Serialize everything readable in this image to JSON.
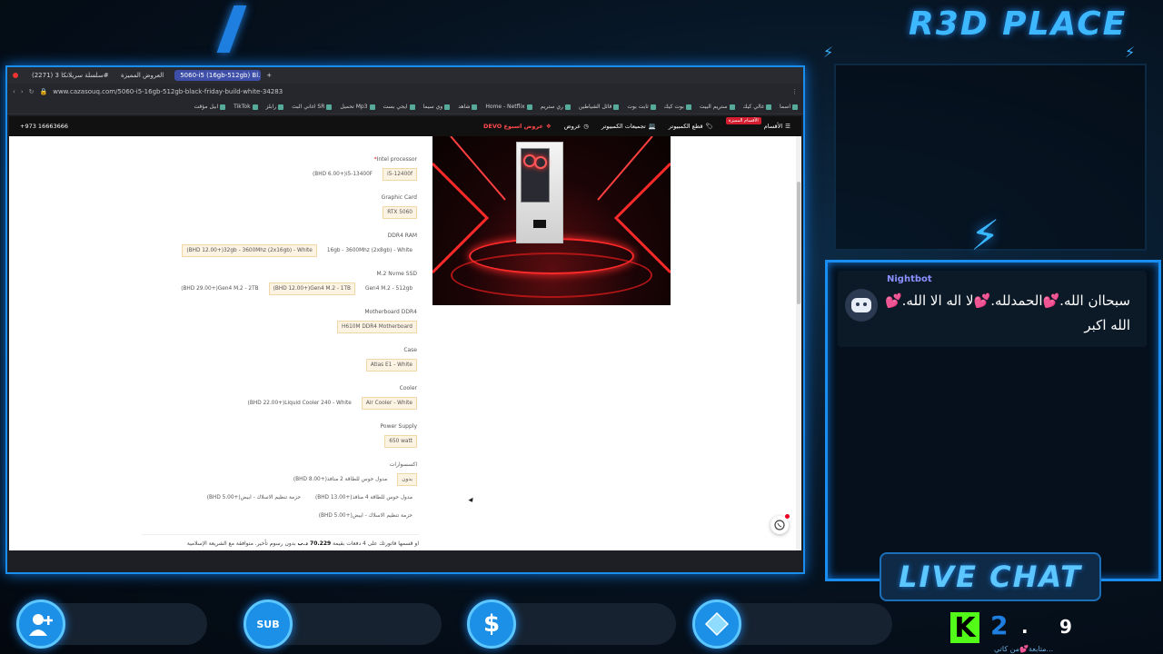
{
  "overlay": {
    "brand": "R3D PLACE",
    "live_chat": "LIVE CHAT",
    "chat": {
      "user": "Nightbot",
      "message": "سبحاان الله.💕الحمدلله.💕لا اله الا الله.💕 الله اكبر"
    },
    "social": {
      "sub_label": "SUB",
      "dollar": "$"
    },
    "kick": {
      "logo": "K",
      "count_a": "2",
      "separator": ".",
      "count_b": "9",
      "subtitle": "متابعة💕من كاتي..."
    },
    "accent": "#1a8ef0"
  },
  "browser": {
    "tabs": [
      {
        "label": "(2271) سلسلة سريلانكا 3#"
      },
      {
        "label": "العروض المميزة"
      },
      {
        "label": "5060-i5 (16gb-512gb) Bl...",
        "active": true
      }
    ],
    "url": "www.cazasouq.com/5060-i5-16gb-512gb-black-friday-build-white-34283",
    "bookmarks": [
      "اسما",
      "غالي كيك",
      "ستريم البيت",
      "بوت كيك",
      "ثابت بوت",
      "قائل الشياطين",
      "ري ستريم",
      "Home - Netflix",
      "شاهد",
      "وي سيما",
      "ايجي بست",
      "Mp3 تحميل",
      "SR اغاني البث",
      "رابلز",
      "TikTok",
      "ابيل مؤقت"
    ]
  },
  "site": {
    "nav": {
      "phone": "+973 16663666",
      "items": [
        {
          "label": "الأقسام",
          "badge": "الأقسام المميزة"
        },
        {
          "label": "قطع الكمبيوتر"
        },
        {
          "label": "تجميعات الكمبيوتر"
        },
        {
          "label": "عروض"
        },
        {
          "label": "عروض اسبوع DEVO"
        }
      ]
    },
    "options": [
      {
        "label": "Intel processor",
        "required": true,
        "chips": [
          {
            "text": "i5-12400f",
            "selected": true
          },
          {
            "text": "(BHD 6.00+)i5-13400F"
          }
        ]
      },
      {
        "label": "Graphic Card",
        "chips": [
          {
            "text": "RTX 5060",
            "selected": true
          }
        ]
      },
      {
        "label": "DDR4 RAM",
        "chips": [
          {
            "text": "16gb - 3600Mhz (2x8gb) - White"
          },
          {
            "text": "(BHD 12.00+)32gb - 3600Mhz (2x16gb) - White",
            "selected": true
          }
        ]
      },
      {
        "label": "M.2 Nvme SSD",
        "chips": [
          {
            "text": "Gen4 M.2 - 512gb"
          },
          {
            "text": "(BHD 12.00+)Gen4 M.2 - 1TB",
            "selected": true
          },
          {
            "text": "(BHD 29.00+)Gen4 M.2 - 2TB"
          }
        ]
      },
      {
        "label": "Motherboard DDR4",
        "chips": [
          {
            "text": "H610M DDR4 Motherboard",
            "selected": true
          }
        ]
      },
      {
        "label": "Case",
        "chips": [
          {
            "text": "Atlas E1 - White",
            "selected": true
          }
        ]
      },
      {
        "label": "Cooler",
        "chips": [
          {
            "text": "Air Cooler - White",
            "selected": true
          },
          {
            "text": "(BHD 22.00+)Liquid Cooler 240 - White"
          }
        ]
      },
      {
        "label": "Power Supply",
        "chips": [
          {
            "text": "650 watt",
            "selected": true
          }
        ]
      },
      {
        "label": "اكسسوارات",
        "chips": [
          {
            "text": "بدون",
            "selected": true
          },
          {
            "text": "(BHD 8.00+)مدول حوس للطاقة 2 منافذ"
          },
          {
            "text": "(BHD 13.00+)مدول حوس للطاقة 4 منافذ"
          },
          {
            "text": "(BHD 5.00+)حزمة تنظيم الاسلاك - ابيض"
          },
          {
            "text": "(BHD 5.00+)حزمة تنظيم الاسلاك - ابيض"
          }
        ]
      }
    ],
    "installment": {
      "prefix": "او قسمها فاتورتك على 4 دفعات بقيمة",
      "amount": "70.229 د.ب",
      "suffix": "بدون رسوم تأخير. متوافقة مع الشريعة الإسلامية"
    }
  }
}
